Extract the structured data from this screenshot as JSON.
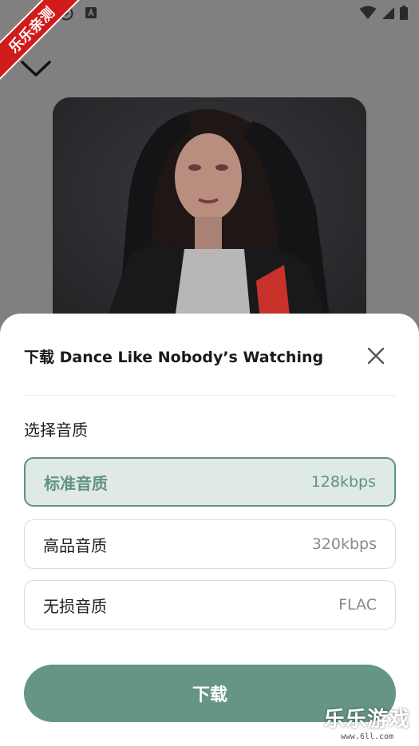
{
  "corner_badge": {
    "label": "乐乐亲测"
  },
  "status_bar": {
    "left_icons": [
      "media-play-icon",
      "text-a-icon"
    ],
    "right_icons": [
      "wifi-icon",
      "signal-icon",
      "battery-icon"
    ]
  },
  "player": {
    "collapse_icon": "chevron-down-icon"
  },
  "sheet": {
    "title": "下载 Dance Like Nobody’s Watching",
    "close_icon": "close-icon",
    "section_label": "选择音质",
    "options": [
      {
        "name": "标准音质",
        "rate": "128kbps",
        "selected": true
      },
      {
        "name": "高品音质",
        "rate": "320kbps",
        "selected": false
      },
      {
        "name": "无损音质",
        "rate": "FLAC",
        "selected": false
      }
    ],
    "download_label": "下载"
  },
  "watermark": {
    "title": "乐乐游戏",
    "url": "www.6ll.com"
  },
  "colors": {
    "accent": "#649586",
    "selected_bg": "#dfe9e6",
    "overlay": "#808080"
  }
}
